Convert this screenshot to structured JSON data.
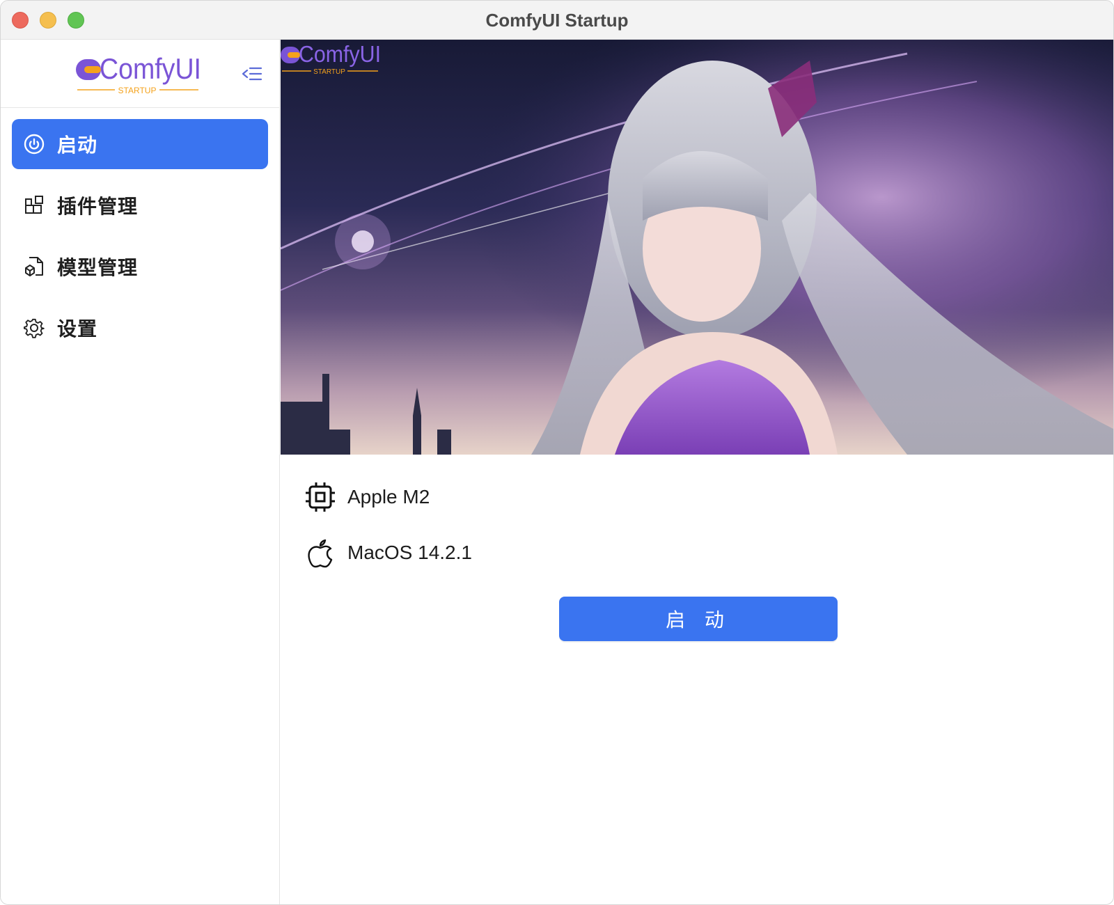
{
  "window": {
    "title": "ComfyUI Startup"
  },
  "sidebar": {
    "logo_text": "ComfyUI",
    "logo_subtext": "STARTUP",
    "items": [
      {
        "label": "启动",
        "icon": "power-icon",
        "active": true
      },
      {
        "label": "插件管理",
        "icon": "plugin-blocks-icon",
        "active": false
      },
      {
        "label": "模型管理",
        "icon": "model-file-icon",
        "active": false
      },
      {
        "label": "设置",
        "icon": "gear-icon",
        "active": false
      }
    ]
  },
  "main": {
    "banner": {
      "logo_text": "ComfyUI",
      "logo_subtext": "STARTUP"
    },
    "chip": "Apple M2",
    "os": "MacOS 14.2.1",
    "start_button": "启 动"
  },
  "colors": {
    "accent": "#3a74f0",
    "logo_purple": "#7a54d6",
    "logo_orange": "#f4a21b"
  }
}
